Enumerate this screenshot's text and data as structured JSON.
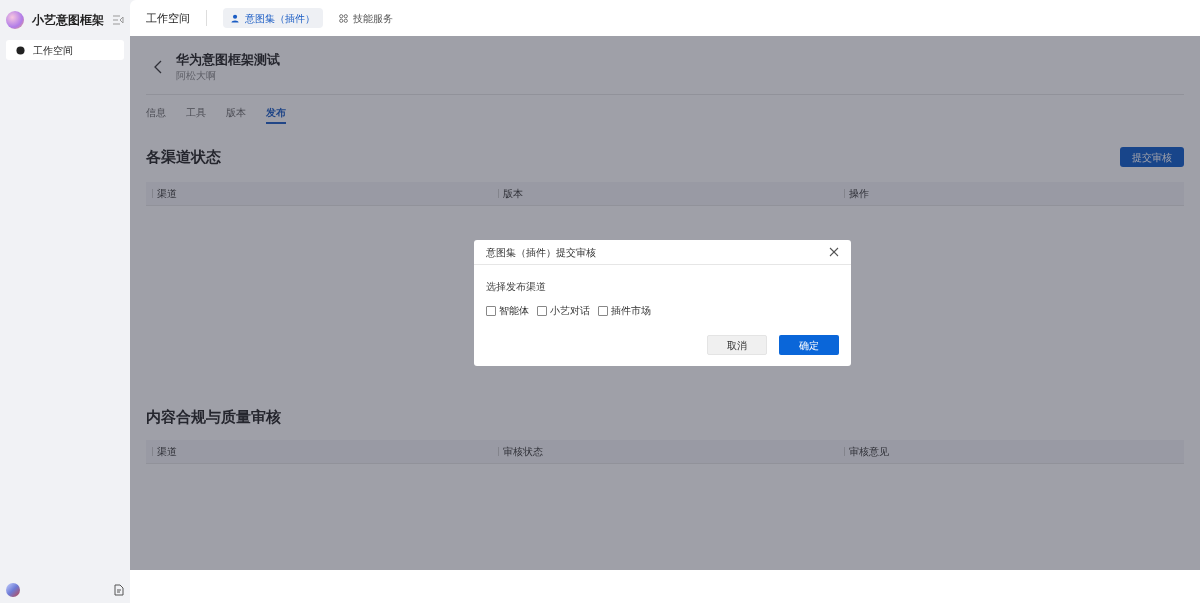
{
  "sidebar": {
    "app_name": "小艺意图框架",
    "items": [
      {
        "label": "工作空间",
        "selected": true
      }
    ]
  },
  "top_nav": {
    "title": "工作空间",
    "tabs": [
      {
        "label": "意图集（插件）",
        "selected": true
      },
      {
        "label": "技能服务",
        "selected": false
      }
    ]
  },
  "page": {
    "title": "华为意图框架测试",
    "subtitle": "阿松大啊",
    "tabs": [
      {
        "label": "信息",
        "selected": false
      },
      {
        "label": "工具",
        "selected": false
      },
      {
        "label": "版本",
        "selected": false
      },
      {
        "label": "发布",
        "selected": true
      }
    ]
  },
  "channel_status": {
    "heading": "各渠道状态",
    "button": "提交审核",
    "columns": [
      "渠道",
      "版本",
      "操作"
    ]
  },
  "review": {
    "heading": "内容合规与质量审核",
    "columns": [
      "渠道",
      "审核状态",
      "审核意见"
    ]
  },
  "dialog": {
    "title": "意图集（插件）提交审核",
    "label": "选择发布渠道",
    "options": [
      {
        "label": "智能体",
        "checked": false
      },
      {
        "label": "小艺对话",
        "checked": false
      },
      {
        "label": "插件市场",
        "checked": false
      }
    ],
    "cancel": "取消",
    "confirm": "确定"
  }
}
